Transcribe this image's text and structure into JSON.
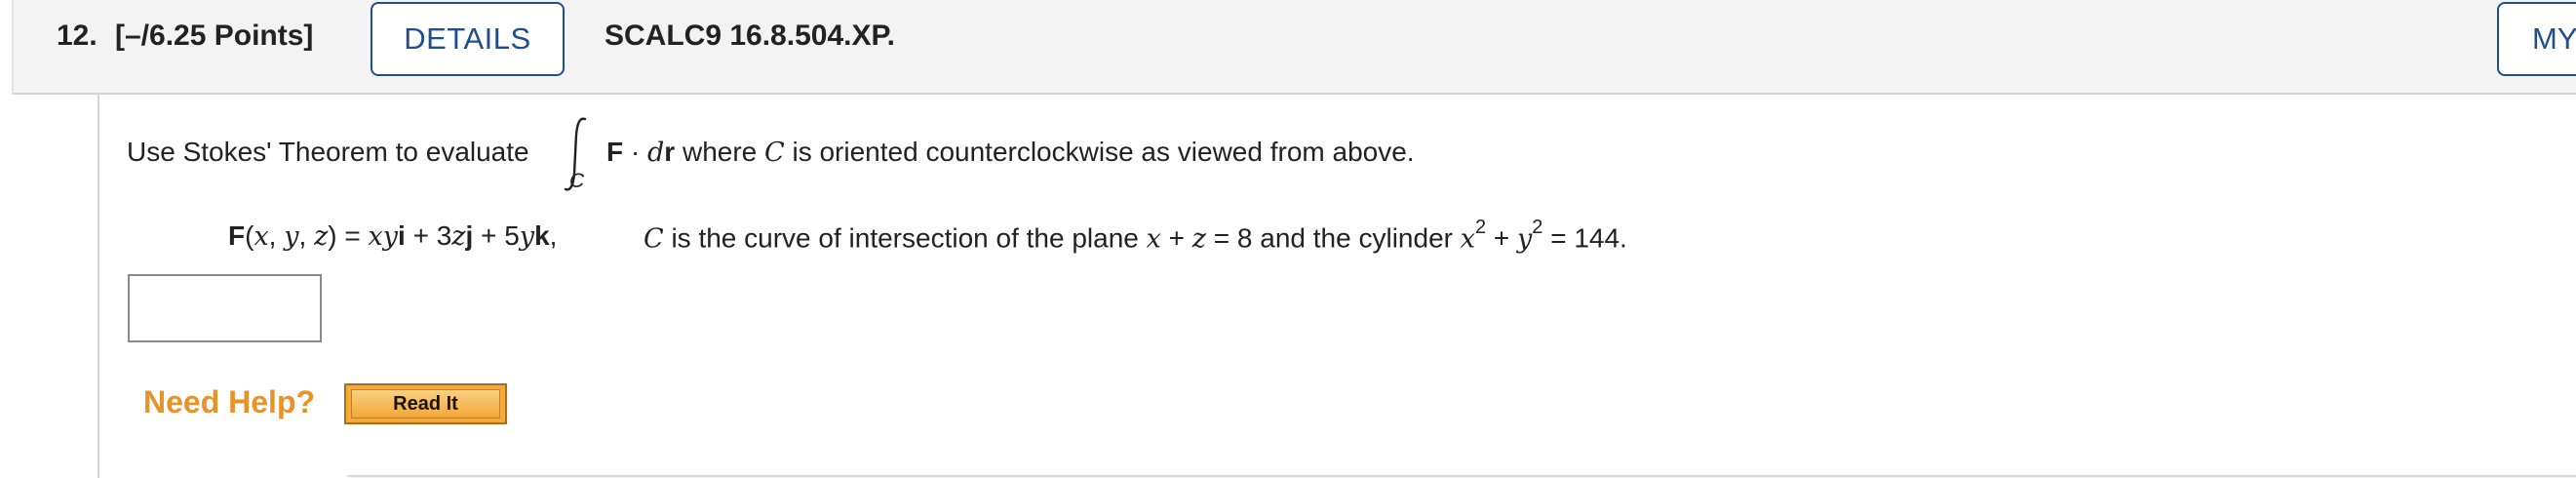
{
  "header": {
    "question_number": "12.",
    "points": "[–/6.25 Points]",
    "details_label": "DETAILS",
    "code": "SCALC9 16.8.504.XP.",
    "my_notes_label": "MY NOTES"
  },
  "problem": {
    "intro": "Use Stokes' Theorem to evaluate",
    "integral_subscript": "C",
    "integrand_F": "F",
    "integrand_dot": " · ",
    "integrand_d": "d",
    "integrand_r": "r",
    "where_text": " where ",
    "where_C": "C",
    "orientation_text": " is oriented counterclockwise as viewed from above.",
    "field": {
      "F": "F",
      "args_open": "(",
      "x": "x",
      "comma1": ", ",
      "y": "y",
      "comma2": ", ",
      "z": "z",
      "args_close": ") = ",
      "term1_coef_x": "x",
      "term1_coef_y": "y",
      "term1_unit": "i",
      "plus1": " + 3",
      "term2_var": "z",
      "term2_unit": "j",
      "plus2": " + 5",
      "term3_var": "y",
      "term3_unit": "k",
      "trailing": ","
    },
    "curve": {
      "C": "C",
      "text1": " is the curve of intersection of the plane ",
      "x": "x",
      "plus": " + ",
      "z": "z",
      "eq1": " = 8 and the cylinder ",
      "x2": "x",
      "exp1": "2",
      "plus2": " + ",
      "y2": "y",
      "exp2": "2",
      "eq2": " = 144."
    }
  },
  "answer": {
    "value": ""
  },
  "help": {
    "label": "Need Help?",
    "read_it_label": "Read It"
  },
  "colors": {
    "accent": "#1f4e8c",
    "help_orange": "#e8922a",
    "button_orange": "#f3a93c"
  }
}
